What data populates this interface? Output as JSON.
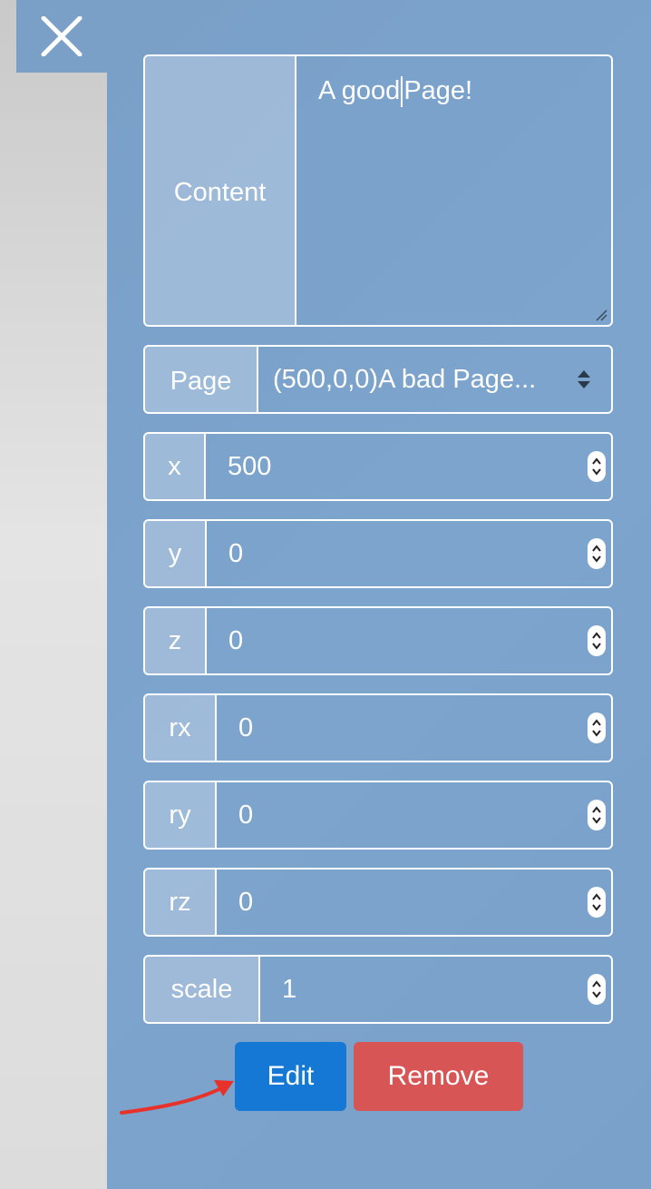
{
  "close": {
    "icon": "close-icon"
  },
  "form": {
    "content": {
      "label": "Content",
      "value_before_cursor": "A good",
      "value_after_cursor": "Page!"
    },
    "page": {
      "label": "Page",
      "selected": "(500,0,0)A bad Page..."
    },
    "fields": [
      {
        "key": "x",
        "label": "x",
        "value": "500"
      },
      {
        "key": "y",
        "label": "y",
        "value": "0"
      },
      {
        "key": "z",
        "label": "z",
        "value": "0"
      },
      {
        "key": "rx",
        "label": "rx",
        "value": "0"
      },
      {
        "key": "ry",
        "label": "ry",
        "value": "0"
      },
      {
        "key": "rz",
        "label": "rz",
        "value": "0"
      },
      {
        "key": "scale",
        "label": "scale",
        "value": "1"
      }
    ]
  },
  "buttons": {
    "edit": "Edit",
    "remove": "Remove"
  },
  "colors": {
    "panel": "#7aa0c8",
    "edit": "#1478d4",
    "remove": "#d75555",
    "annotation_arrow": "#e8312a"
  }
}
